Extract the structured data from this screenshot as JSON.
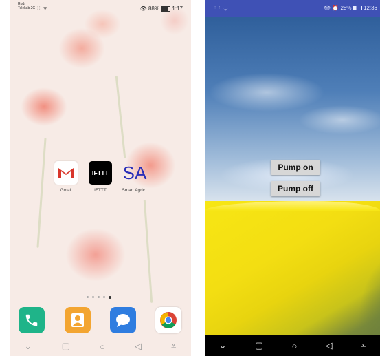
{
  "left_phone": {
    "status_bar": {
      "carrier_line1": "Ro&i",
      "carrier_line2": "Telekab 2G",
      "signal": "⫶⫶ ᯤ",
      "battery_text": "88%",
      "time": "1:17"
    },
    "apps": [
      {
        "label": "Gmail",
        "icon": "gmail-icon"
      },
      {
        "label": "IFTTT",
        "icon": "ifttt-icon",
        "tile_text": "IFTTT"
      },
      {
        "label": "Smart Agric..",
        "icon": "sa-icon",
        "tile_text": "SA"
      }
    ],
    "dock": [
      {
        "icon": "phone-icon",
        "color": "#1fb489"
      },
      {
        "icon": "contacts-icon",
        "color": "#f3a531"
      },
      {
        "icon": "messages-icon",
        "color": "#2f7de0"
      },
      {
        "icon": "chrome-icon",
        "color": "#ffffff"
      }
    ],
    "page_dots": 5,
    "active_dot": 4
  },
  "right_phone": {
    "status_bar": {
      "signal": "⫶ ⫶ ᯤ",
      "status_text": "28%",
      "time": "12:36",
      "color": "#3f51b5"
    },
    "buttons": {
      "pump_on": "Pump on",
      "pump_off": "Pump off"
    }
  }
}
